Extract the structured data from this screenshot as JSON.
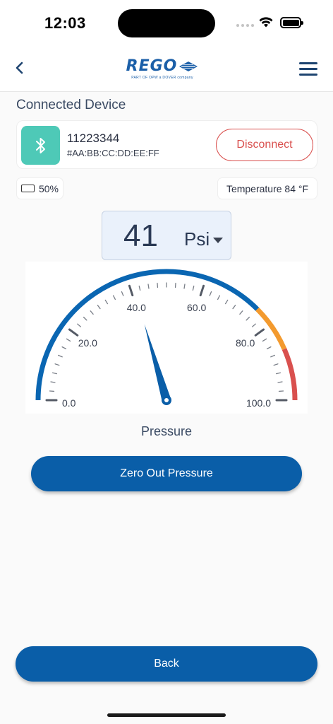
{
  "status_bar": {
    "time": "12:03",
    "icons": [
      "cellular-signal-icon",
      "wifi-icon",
      "battery-icon"
    ]
  },
  "nav": {
    "back_icon": "chevron-left-icon",
    "logo_text": "REGO",
    "logo_tagline": "PART OF OPW  a DOVER company",
    "menu_icon": "hamburger-menu-icon"
  },
  "connected_device": {
    "title": "Connected Device",
    "icon": "bluetooth-icon",
    "device_id": "11223344",
    "mac": "#AA:BB:CC:DD:EE:FF",
    "disconnect_label": "Disconnect"
  },
  "battery": {
    "label": "50%",
    "level": 0.5
  },
  "temperature": {
    "label": "Temperature 84 °F"
  },
  "reading": {
    "value": "41",
    "unit": "Psi"
  },
  "gauge": {
    "min": 0,
    "max": 100,
    "value": 41,
    "tick_labels": [
      "0.0",
      "20.0",
      "40.0",
      "60.0",
      "80.0",
      "100.0"
    ],
    "bands": [
      {
        "from": 0,
        "to": 75,
        "color": "#0a66b2"
      },
      {
        "from": 75,
        "to": 87,
        "color": "#f39a2e"
      },
      {
        "from": 87,
        "to": 100,
        "color": "#d9504e"
      }
    ],
    "needle_color": "#0a5ea8",
    "caption": "Pressure"
  },
  "actions": {
    "zero_label": "Zero Out Pressure",
    "back_label": "Back"
  }
}
